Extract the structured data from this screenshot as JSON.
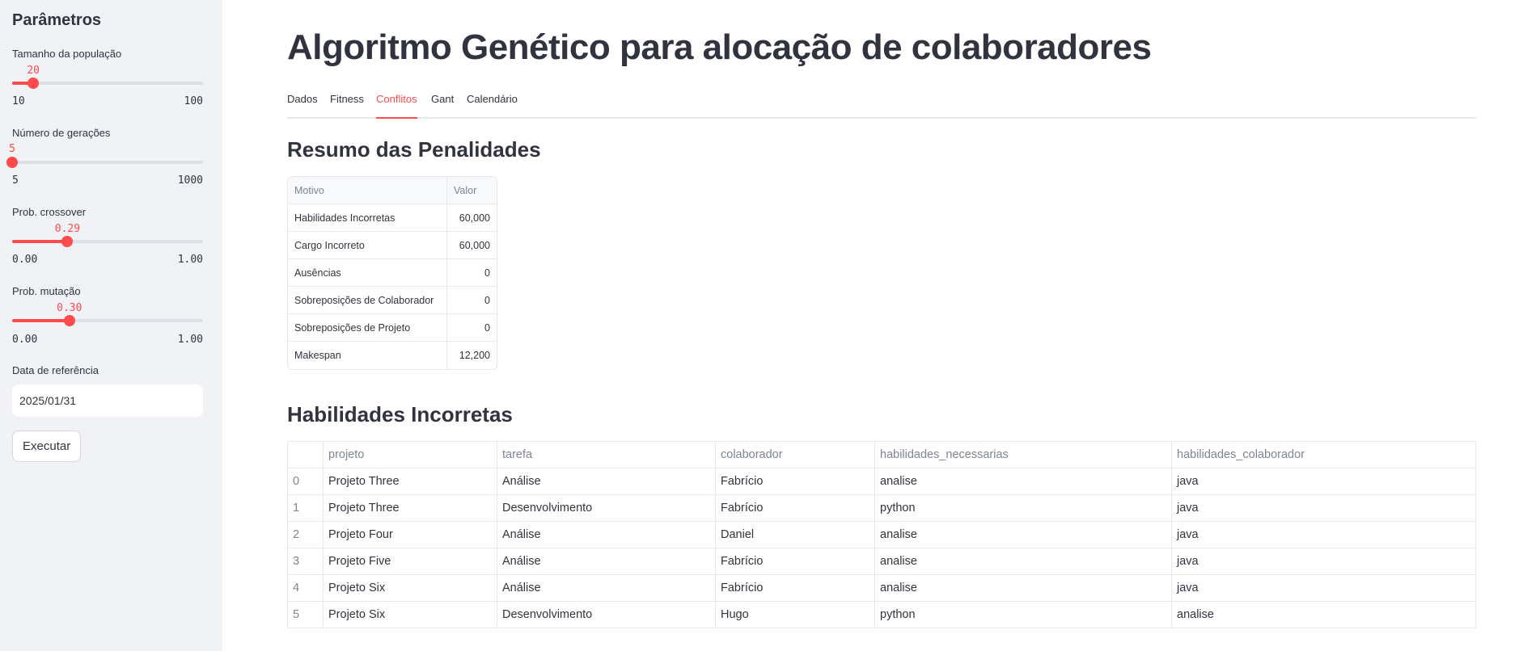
{
  "sidebar": {
    "title": "Parâmetros",
    "sliders": [
      {
        "label": "Tamanho da população",
        "value_text": "20",
        "min_text": "10",
        "max_text": "100",
        "fraction": 0.111
      },
      {
        "label": "Número de gerações",
        "value_text": "5",
        "min_text": "5",
        "max_text": "1000",
        "fraction": 0.0
      },
      {
        "label": "Prob. crossover",
        "value_text": "0.29",
        "min_text": "0.00",
        "max_text": "1.00",
        "fraction": 0.29
      },
      {
        "label": "Prob. mutação",
        "value_text": "0.30",
        "min_text": "0.00",
        "max_text": "1.00",
        "fraction": 0.3
      }
    ],
    "date_label": "Data de referência",
    "date_value": "2025/01/31",
    "run_label": "Executar"
  },
  "main": {
    "title": "Algoritmo Genético para alocação de colaboradores",
    "tabs": [
      {
        "label": "Dados",
        "active": false
      },
      {
        "label": "Fitness",
        "active": false
      },
      {
        "label": "Conflitos",
        "active": true
      },
      {
        "label": "Gant",
        "active": false
      },
      {
        "label": "Calendário",
        "active": false
      }
    ],
    "summary": {
      "title": "Resumo das Penalidades",
      "headers": [
        "Motivo",
        "Valor"
      ],
      "rows": [
        [
          "Habilidades Incorretas",
          "60,000"
        ],
        [
          "Cargo Incorreto",
          "60,000"
        ],
        [
          "Ausências",
          "0"
        ],
        [
          "Sobreposições de Colaborador",
          "0"
        ],
        [
          "Sobreposições de Projeto",
          "0"
        ],
        [
          "Makespan",
          "12,200"
        ]
      ]
    },
    "skills": {
      "title": "Habilidades Incorretas",
      "headers": [
        "",
        "projeto",
        "tarefa",
        "colaborador",
        "habilidades_necessarias",
        "habilidades_colaborador"
      ],
      "rows": [
        [
          "0",
          "Projeto Three",
          "Análise",
          "Fabrício",
          "analise",
          "java"
        ],
        [
          "1",
          "Projeto Three",
          "Desenvolvimento",
          "Fabrício",
          "python",
          "java"
        ],
        [
          "2",
          "Projeto Four",
          "Análise",
          "Daniel",
          "analise",
          "java"
        ],
        [
          "3",
          "Projeto Five",
          "Análise",
          "Fabrício",
          "analise",
          "java"
        ],
        [
          "4",
          "Projeto Six",
          "Análise",
          "Fabrício",
          "analise",
          "java"
        ],
        [
          "5",
          "Projeto Six",
          "Desenvolvimento",
          "Hugo",
          "python",
          "analise"
        ]
      ]
    }
  },
  "colors": {
    "accent": "#ff4b4b",
    "sidebar_bg": "#f0f2f6",
    "text": "#31333f",
    "muted": "#808495"
  }
}
